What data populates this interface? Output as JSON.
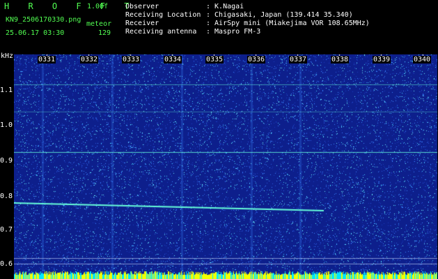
{
  "header": {
    "brand": "H R O F F T",
    "version": "1.00f",
    "filename": "KN9_2506170330.png",
    "mode": "meteor",
    "datetime": "25.06.17 03:30",
    "count": "129",
    "info": [
      {
        "label": "Observer",
        "value": ": K.Nagai"
      },
      {
        "label": "Receiving Location",
        "value": ": Chigasaki, Japan (139.414 35.340)"
      },
      {
        "label": "Receiver",
        "value": ": AirSpy mini (Miakejima VOR 108.65MHz)"
      },
      {
        "label": "Receiving antenna",
        "value": ": Maspro FM-3"
      }
    ]
  },
  "spectrogram": {
    "y_unit": "kHz",
    "y_ticks": [
      "1.1",
      "1.0",
      "0.9",
      "0.8",
      "0.7",
      "0.6"
    ],
    "time_labels": [
      "0331",
      "0332",
      "0333",
      "0334",
      "0335",
      "0336",
      "0337",
      "0338",
      "0339",
      "0340"
    ],
    "colors": {
      "background": "#0d1f8c",
      "noise": "#46d3ff",
      "line": "#66ffd9",
      "bottom_band": "#f2ff00"
    }
  }
}
